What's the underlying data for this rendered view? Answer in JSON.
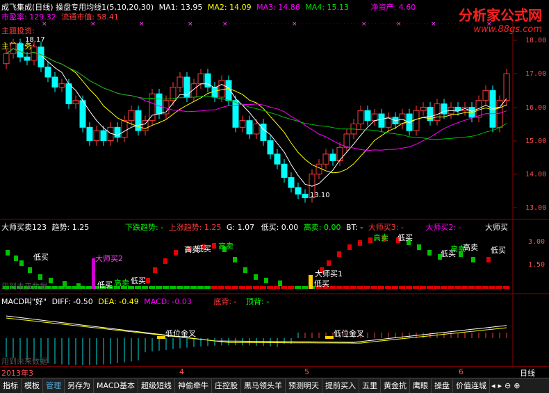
{
  "title_bar": {
    "stock": "成飞集成(日线)",
    "indicator": "操盘专用均线1(5,10,20,30)",
    "ma1": "MA1: 13.95",
    "ma2": "MA2: 14.09",
    "ma3": "MA3: 14.86",
    "ma4": "MA4: 15.13",
    "net_assets": "净资产: 4.60"
  },
  "line2": {
    "pe": "市盈率: 129.32",
    "float_cap": "流通市值: 58.41"
  },
  "labels": {
    "theme": "主题投资:",
    "business": "主营业务:",
    "high": "18.17",
    "low": "13.10"
  },
  "price_axis": [
    "18.00",
    "17.00",
    "16.00",
    "15.00",
    "14.00",
    "13.00"
  ],
  "panel2": {
    "name": "大师买卖123",
    "trend": "趋势: 1.25",
    "down": "下跌趋势: -",
    "up": "上涨趋势: 1.25",
    "g": "G: 1.07",
    "low_buy": "低买: 0.00",
    "high_sell": "高卖: 0.00",
    "bt": "BT: -",
    "m3": "大师买3: -",
    "m2": "大师买2: -",
    "corner": "大师买",
    "axis": [
      "3.00",
      "1.50"
    ],
    "future": "用到未来数据",
    "marks": {
      "low1": "低买",
      "m2": "大师买2",
      "low2": "低买",
      "high1": "高卖",
      "low3": "低买",
      "high2": "高卖",
      "low4": "低买",
      "high3": "高卖",
      "m1": "大师买1",
      "low5": "低买",
      "high4": "高卖",
      "low6": "低买",
      "low7": "低买",
      "high5": "高卖",
      "high6": "高卖",
      "low8": "低买"
    }
  },
  "panel3": {
    "name": "MACD叫\"好\"",
    "diff": "DIFF: -0.50",
    "dea": "DEA: -0.49",
    "macd": "MACD: -0.03",
    "bottom_div": "底背: -",
    "top_div": "顶背: -",
    "golden1": "低位金叉",
    "golden2": "低位金叉",
    "future": "用到未来数据"
  },
  "dates": [
    "2013年3",
    "4",
    "5",
    "6"
  ],
  "period": "日线",
  "tabs": [
    "指标",
    "模板",
    "管理",
    "另存为",
    "MACD基本",
    "超级短线",
    "神偷牵牛",
    "庄控股",
    "黑马领头羊",
    "预测明天",
    "提前买入",
    "五里",
    "黄金抗",
    "鹰眼",
    "操盘",
    "价值连城"
  ],
  "watermark": {
    "title": "分析家公式网",
    "url": "www.88gs.com"
  },
  "colors": {
    "up": "#ff3c3c",
    "down": "#00ffff",
    "ma1": "#ffffff",
    "ma2": "#ffff00",
    "ma3": "#ff00ff",
    "ma4": "#00c000"
  }
}
